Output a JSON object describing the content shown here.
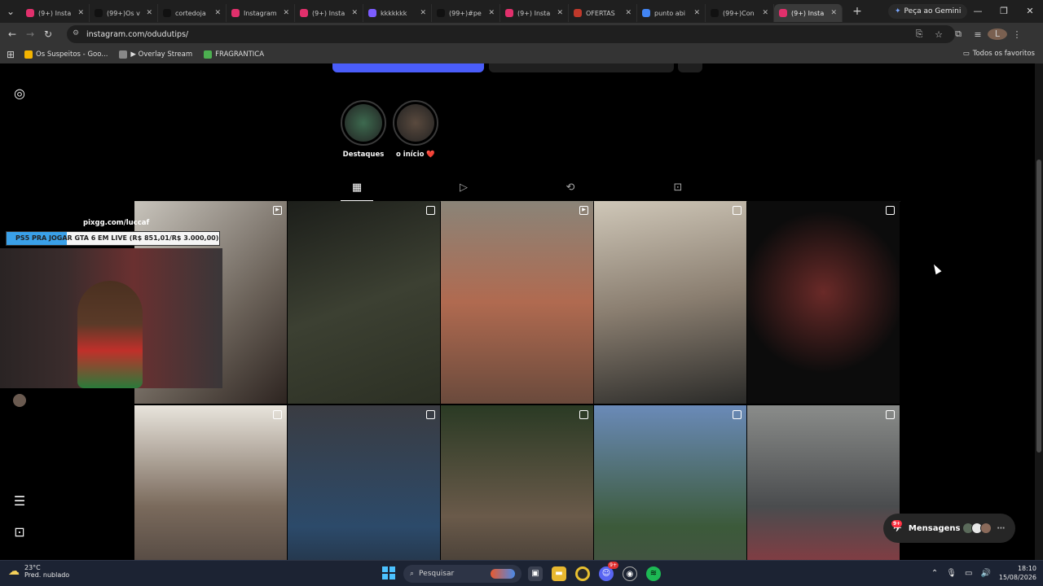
{
  "browser": {
    "tabs": [
      {
        "title": "(9+) Insta",
        "fav": "#e1306c"
      },
      {
        "title": "(99+)Os v",
        "fav": "#111111"
      },
      {
        "title": "cortedoja",
        "fav": "#111111"
      },
      {
        "title": "Instagram",
        "fav": "#e1306c"
      },
      {
        "title": "(9+) Insta",
        "fav": "#e1306c"
      },
      {
        "title": "kkkkkkk",
        "fav": "#7b5cff"
      },
      {
        "title": "(99+)#pe",
        "fav": "#111111"
      },
      {
        "title": "(9+) Insta",
        "fav": "#e1306c"
      },
      {
        "title": "OFERTAS",
        "fav": "#c0392b"
      },
      {
        "title": "punto abi",
        "fav": "#4285f4"
      },
      {
        "title": "(99+)Con",
        "fav": "#111111"
      },
      {
        "title": "(9+) Insta",
        "fav": "#e1306c",
        "active": true
      }
    ],
    "gemini_label": "Peça ao Gemini",
    "url": "instagram.com/odudutips/",
    "profile_letter": "L",
    "bookmarks": [
      {
        "label": "Os Suspeitos - Goo...",
        "color": "#f4b400"
      },
      {
        "label": "▶ Overlay Stream",
        "color": "#888888"
      },
      {
        "label": "FRAGRANTICA",
        "color": "#4caf50"
      }
    ],
    "all_bookmarks_label": "Todos os favoritos"
  },
  "profile": {
    "highlights": [
      {
        "label": "Destaques",
        "color": "#3d6a4f"
      },
      {
        "label": "o início ❤️",
        "color": "#5a4a3e"
      }
    ],
    "tabs": [
      "grid-icon",
      "reels-icon",
      "reposts-icon",
      "tagged-icon"
    ],
    "posts": [
      {
        "type": "reel",
        "bg": "linear-gradient(135deg,#c8c4bc,#6b6259 60%,#2d2420)"
      },
      {
        "type": "post",
        "bg": "linear-gradient(160deg,#1c1e1a,#3c4032 50%,#2c3024)"
      },
      {
        "type": "reel",
        "bg": "linear-gradient(180deg,#8a8478,#b06a50 50%,#6a4a3c)"
      },
      {
        "type": "post",
        "bg": "linear-gradient(170deg,#cfc7b8,#8a7e70 50%,#2a2a28)"
      },
      {
        "type": "post",
        "bg": "radial-gradient(circle at 50% 45%,#6a2a28,#0c0c0c 60%)"
      },
      {
        "type": "post",
        "bg": "linear-gradient(180deg,#e8e4dc,#7a6a5c 50%,#3a3230)"
      },
      {
        "type": "post",
        "bg": "linear-gradient(180deg,#3a3c42,#2c4a6a 60%,#1c2028)"
      },
      {
        "type": "post",
        "bg": "linear-gradient(180deg,#2a3a24,#6a5a4a 55%,#2c2a28)"
      },
      {
        "type": "post",
        "bg": "linear-gradient(180deg,#6a8ab8,#3c5a3a 60%,#4a4a4a)"
      },
      {
        "type": "post",
        "bg": "linear-gradient(180deg,#8a8c8a,#4a4c4e 50%,#b0303a)"
      }
    ]
  },
  "overlay": {
    "url": "pixgg.com/luccaf",
    "goal_text": "PS5 PRA JOGAR GTA 6 EM LIVE (R$ 851,01/R$ 3.000,00)",
    "goal_current": 851.01,
    "goal_target": 3000.0
  },
  "messages": {
    "label": "Mensagens",
    "badge": "9+"
  },
  "taskbar": {
    "temp": "23°C",
    "weather": "Pred. nublado",
    "search_placeholder": "Pesquisar",
    "time": "18:10",
    "date": "15/08/2026",
    "discord_badge": "9+"
  }
}
